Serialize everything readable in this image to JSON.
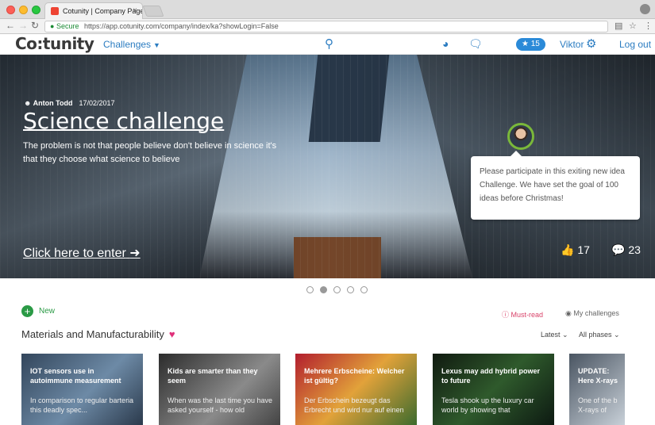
{
  "browser": {
    "tab_title": "Cotunity | Company Page",
    "tab_close": "×",
    "secure_label": "Secure",
    "url": "https://app.cotunity.com/company/index/ka?showLogin=False"
  },
  "header": {
    "logo": "Co:tunity",
    "challenges_label": "Challenges",
    "badge_count": "★ 15",
    "user_name": "Viktor",
    "logout_label": "Log out"
  },
  "hero": {
    "author": "Anton Todd",
    "date": "17/02/2017",
    "title": "Science challenge",
    "description": "The problem is not that people believe don't believe in science it's that they choose what science to believe",
    "enter_label": "Click here to enter",
    "likes": "17",
    "comments": "23",
    "bubble_text": "Please participate in this exiting new idea Challenge. We have set the goal of 100 ideas before Christmas!",
    "carousel": {
      "count": 5,
      "active": 2
    }
  },
  "toolbar": {
    "new_label": "New",
    "must_read_label": "Must-read",
    "my_challenges_label": "My challenges"
  },
  "section": {
    "title": "Materials and Manufacturability",
    "sort_label": "Latest",
    "phase_label": "All phases"
  },
  "cards": [
    {
      "title": "IOT sensors use in autoimmune measurement",
      "desc": "In comparison to regular barteria this deadly spec..."
    },
    {
      "title": "Kids are smarter than they seem",
      "desc": "When was the last time you have asked yourself - how old"
    },
    {
      "title": "Mehrere Erbscheine: Welcher ist gültig?",
      "desc": "Der Erbschein bezeugt das Erbrecht und wird nur auf einen"
    },
    {
      "title": "Lexus may add hybrid power to future",
      "desc": "Tesla shook up the luxury car world by showing that"
    },
    {
      "title": "UPDATE: Here X-rays",
      "desc": "One of the b X-rays of"
    }
  ],
  "colors": {
    "brand_blue": "#2b7cc1",
    "new_green": "#2a9a45",
    "must_read_pink": "#d9436a"
  }
}
